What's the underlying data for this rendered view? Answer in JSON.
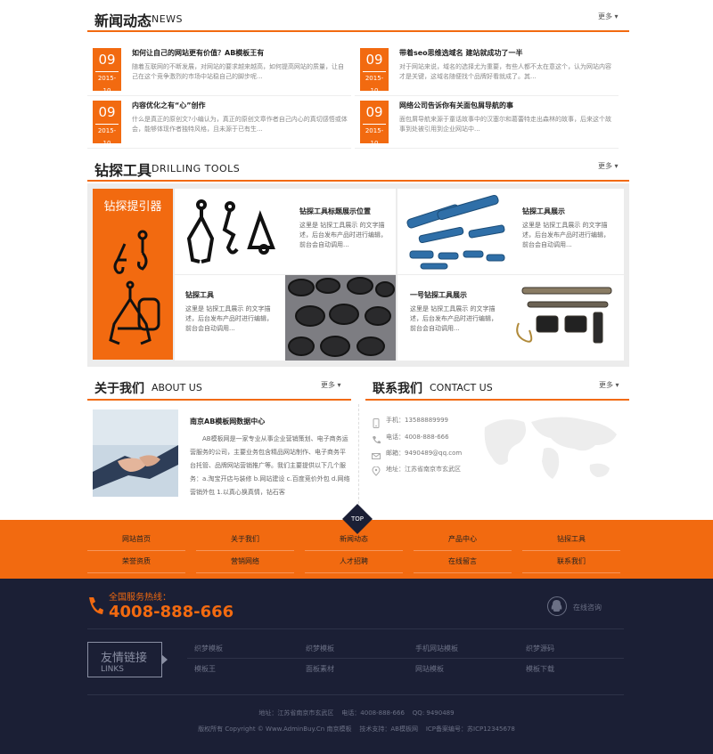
{
  "news": {
    "title_zh": "新闻动态",
    "title_en": "NEWS",
    "more": "更多",
    "items": [
      {
        "day": "09",
        "ym": "2015-10",
        "title": "如何让自己的网站更有价值？AB模板王有",
        "desc": "随着互联网的不断发展，对网站的要求越来越高，如何提高网站的质量，让自己在这个竞争激烈的市场中站稳自己的脚步呢..."
      },
      {
        "day": "09",
        "ym": "2015-10",
        "title": "带着seo思维选域名 建站就成功了一半",
        "desc": "对于网站来说，域名的选择尤为重要，有些人都不太在意这个，认为网站内容才是关键，这域名随便找个品牌好看就成了。其..."
      },
      {
        "day": "09",
        "ym": "2015-10",
        "title": "内容优化之有“心”创作",
        "desc": "什么是真正的原创文?小编认为，真正的原创文章作者自己内心的真切感悟或体会，能够体现作者独特风格，且未源于已有生..."
      },
      {
        "day": "09",
        "ym": "2015-10",
        "title": "网络公司告诉你有关面包屑导航的事",
        "desc": "面包屑导航来源于童话故事中的汉塞尔和葛蕾特走出森林的故事，后来这个故事到处被引用到企业网站中..."
      }
    ]
  },
  "tools": {
    "title_zh": "钻探工具",
    "title_en": "DRILLING TOOLS",
    "more": "更多",
    "feature_label": "钻探提引器",
    "items": [
      {
        "title": "钻探工具标题展示位置",
        "desc": "这里是 钻探工具展示 的文字描述，后台发布产品时进行编辑，前台会自动调用..."
      },
      {
        "title": "钻探工具展示",
        "desc": "这里是 钻探工具展示 的文字描述，后台发布产品时进行编辑，前台会自动调用..."
      },
      {
        "title": "钻探工具",
        "desc": "这里是 钻探工具展示 的文字描述，后台发布产品时进行编辑，前台会自动调用..."
      },
      {
        "title": "一号钻探工具展示",
        "desc": "这里是 钻探工具展示 的文字描述，后台发布产品时进行编辑，前台会自动调用..."
      }
    ]
  },
  "about": {
    "title_zh": "关于我们",
    "title_en": "ABOUT US",
    "more": "更多",
    "company": "南京AB模板网数据中心",
    "desc": "AB模板网是一家专业从事企业营销策划、电子商务运营服务的公司，主要业务包含精品网站制作、电子商务平台托管、品牌网站营销推广等。我们主要提供以下几个服务：a.淘宝开店与装修 b.网站建设 c.百度竞价外包 d.网络营销外包 1.以真心换真情，钻石客"
  },
  "contact": {
    "title_zh": "联系我们",
    "title_en": "CONTACT US",
    "more": "更多",
    "lines": [
      "手机：13588889999",
      "电话：4008-888-666",
      "邮箱：9490489@qq.com",
      "地址：江苏省南京市玄武区"
    ]
  },
  "top_label": "TOP",
  "nav": {
    "row1": [
      "网站首页",
      "关于我们",
      "新闻动态",
      "产品中心",
      "钻探工具"
    ],
    "row2": [
      "荣誉资质",
      "营销网络",
      "人才招聘",
      "在线留言",
      "联系我们"
    ]
  },
  "footer": {
    "hotline_label": "全国服务热线：",
    "hotline": "4008-888-666",
    "online": "在线咨询",
    "links_zh": "友情链接",
    "links_en": "LINKS",
    "links": [
      [
        "织梦模板",
        "织梦模板",
        "手机网站模板",
        "织梦源码"
      ],
      [
        "模板王",
        "面板素材",
        "网站模板",
        "模板下载"
      ]
    ],
    "addr_line": "地址：江苏省南京市玄武区    电话：4008-888-666    QQ: 9490489",
    "copy_line": "版权所有 Copyright © Www.AdminBuy.Cn 南京模板    技术支持：AB模板网    ICP备案编号：苏ICP12345678",
    "colors": {
      "accent": "#f26a10",
      "dark": "#1b1f35"
    }
  }
}
